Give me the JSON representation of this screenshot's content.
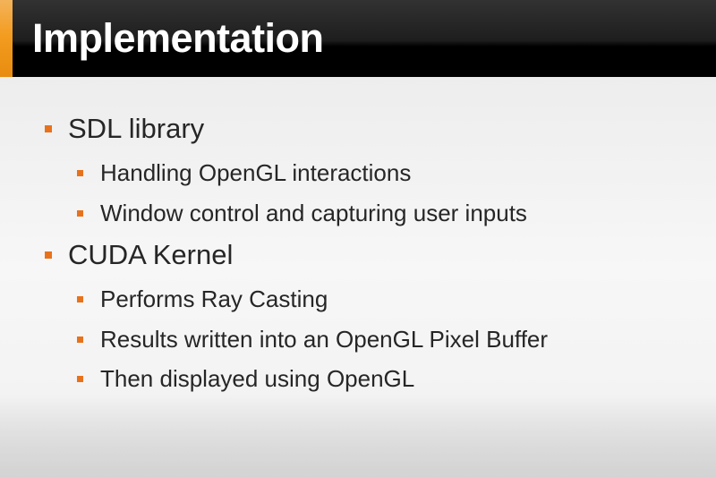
{
  "slide": {
    "title": "Implementation",
    "bullets": [
      {
        "level": 1,
        "text": "SDL library"
      },
      {
        "level": 2,
        "text": "Handling OpenGL interactions"
      },
      {
        "level": 2,
        "text": "Window control and capturing user inputs"
      },
      {
        "level": 1,
        "text": "CUDA Kernel"
      },
      {
        "level": 2,
        "text": "Performs Ray Casting"
      },
      {
        "level": 2,
        "text": "Results written into an OpenGL Pixel Buffer"
      },
      {
        "level": 2,
        "text": "Then displayed using OpenGL"
      }
    ]
  },
  "colors": {
    "title_bar": "#000000",
    "accent": "#f39c1f",
    "bullet": "#e8721c",
    "text": "#262626",
    "title_text": "#ffffff"
  }
}
